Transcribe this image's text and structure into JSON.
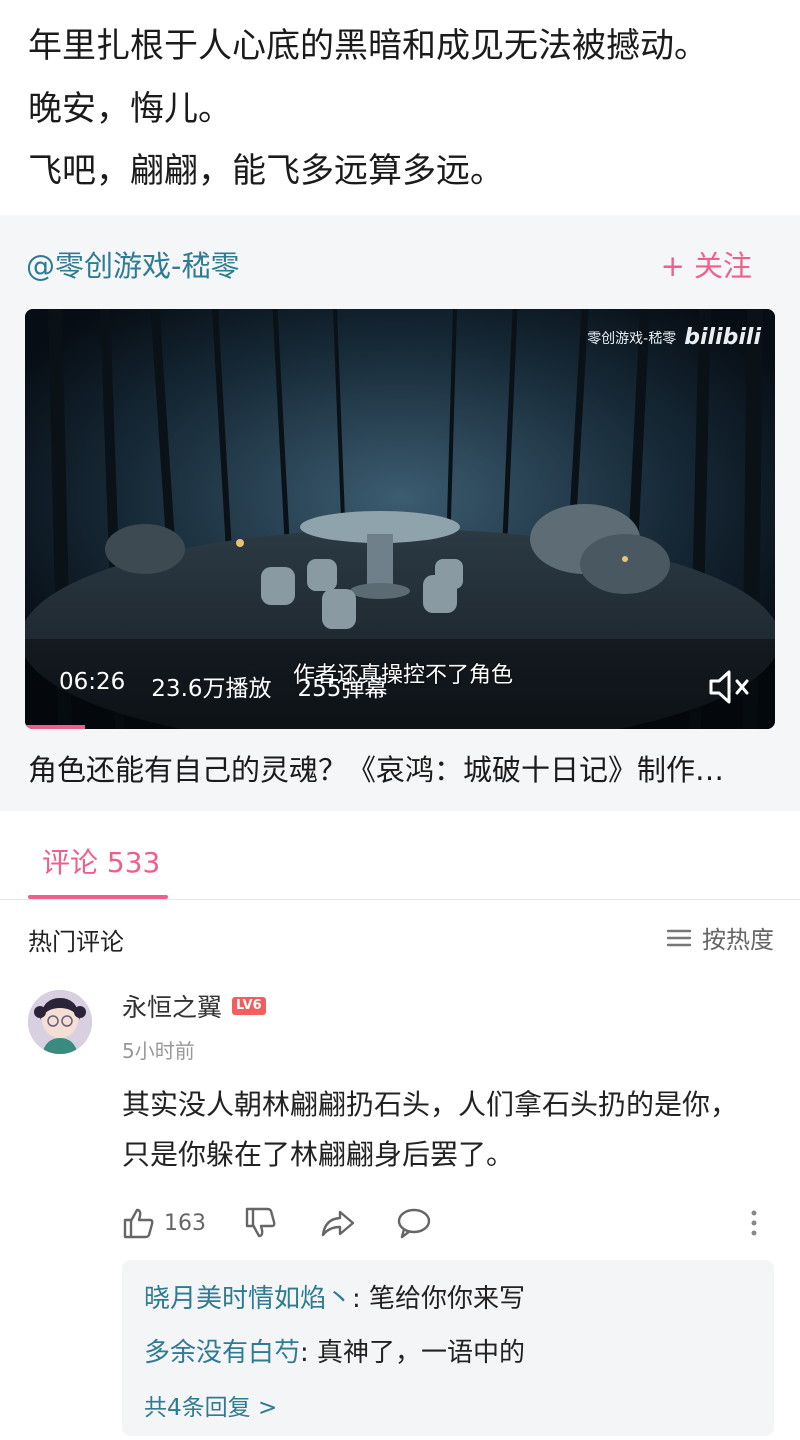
{
  "article": {
    "lines": [
      "年里扎根于人心底的黑暗和成见无法被撼动。",
      "晚安，悔儿。",
      "飞吧，翩翩，能飞多远算多远。"
    ]
  },
  "shared_video": {
    "author": "@零创游戏-嵇零",
    "follow_label": "+ 关注",
    "watermark_text": "零创游戏-嵇零",
    "watermark_logo": "bilibili",
    "duration": "06:26",
    "plays": "23.6万播放",
    "danmaku_count": "255弹幕",
    "danmaku_overlay": "作者还真操控不了角色",
    "title": "角色还能有自己的灵魂？《哀鸿：城破十日记》制作…",
    "progress_fraction": 0.08,
    "accent_color": "#f05f8c"
  },
  "comments_tab": {
    "label": "评论 533"
  },
  "hot_comments": {
    "title": "热门评论",
    "sort_label": "按热度",
    "items": [
      {
        "username": "永恒之翼",
        "level": "LV6",
        "time": "5小时前",
        "text": "其实没人朝林翩翩扔石头，人们拿石头扔的是你，只是你躲在了林翩翩身后罢了。",
        "likes": "163",
        "replies": [
          {
            "name": "晓月美时情如焰丶",
            "text": ": 笔给你你来写"
          },
          {
            "name": "多余没有白芍",
            "text": ": 真神了，一语中的"
          }
        ],
        "more_replies": "共4条回复 >"
      }
    ]
  }
}
